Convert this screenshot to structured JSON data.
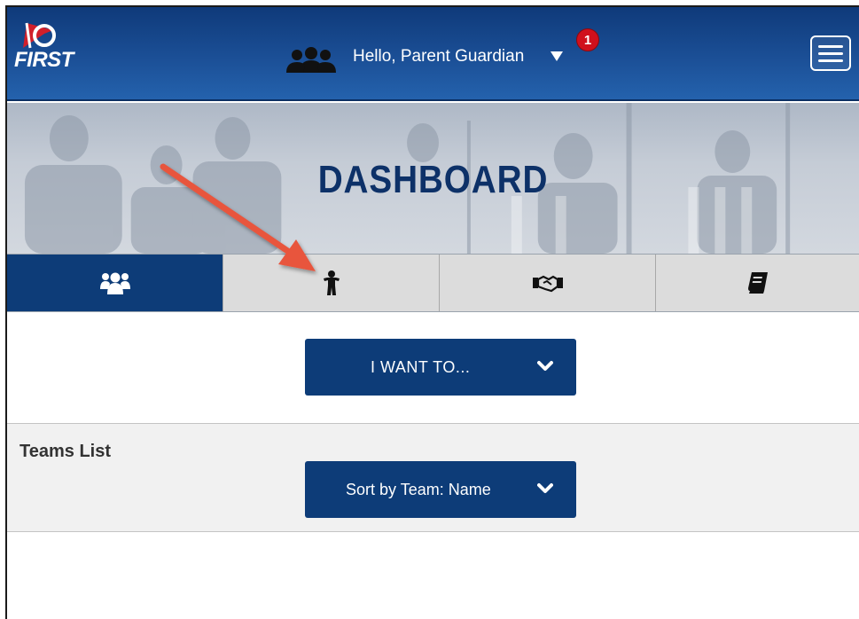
{
  "header": {
    "logo_text": "FIRST",
    "greeting": "Hello, Parent Guardian",
    "notification_count": "1",
    "icons": {
      "users": "users-icon",
      "caret": "caret-down-icon",
      "menu": "hamburger-menu-icon"
    }
  },
  "banner": {
    "title": "DASHBOARD"
  },
  "tabs": [
    {
      "icon": "team-group-icon",
      "active": true
    },
    {
      "icon": "child-icon",
      "active": false
    },
    {
      "icon": "handshake-icon",
      "active": false
    },
    {
      "icon": "book-icon",
      "active": false
    }
  ],
  "actions": {
    "want_to_label": "I WANT TO..."
  },
  "teams": {
    "title": "Teams List",
    "sort_label": "Sort by Team: Name"
  },
  "colors": {
    "primary": "#0d3c78",
    "header": "#1b4f96",
    "badge": "#d0101c",
    "annotation": "#e8543d"
  }
}
